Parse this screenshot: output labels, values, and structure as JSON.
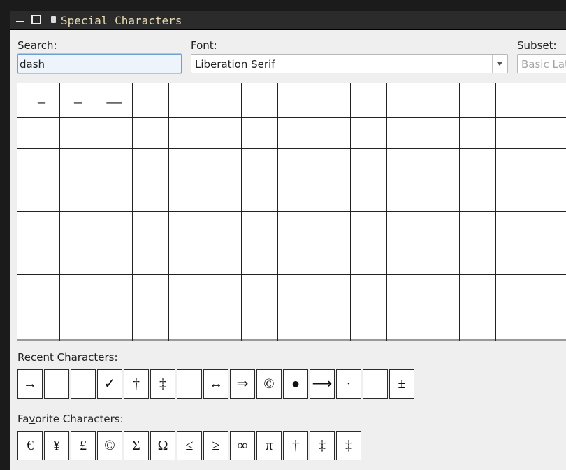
{
  "window": {
    "title": "Special Characters"
  },
  "search": {
    "label_u": "S",
    "label_rest": "earch:",
    "value": "dash"
  },
  "font": {
    "label_u": "F",
    "label_rest": "ont:",
    "value": "Liberation Serif"
  },
  "subset": {
    "label_a": "S",
    "label_u": "u",
    "label_b": "bset:",
    "value": "Basic Latin"
  },
  "charmap": {
    "cells": [
      "‒",
      "–",
      "—"
    ]
  },
  "recent": {
    "label_u": "R",
    "label_rest": "ecent Characters:",
    "items": [
      "→",
      "–",
      "—",
      "✓",
      "†",
      "‡",
      " ",
      "↔",
      "⇒",
      "©",
      "●",
      "⟶",
      "·",
      "–",
      "±"
    ]
  },
  "favorites": {
    "label_a": "Fa",
    "label_u": "v",
    "label_b": "orite Characters:",
    "items": [
      "€",
      "¥",
      "£",
      "©",
      "Σ",
      "Ω",
      "≤",
      "≥",
      "∞",
      "π",
      "†",
      "‡",
      "‡"
    ]
  }
}
